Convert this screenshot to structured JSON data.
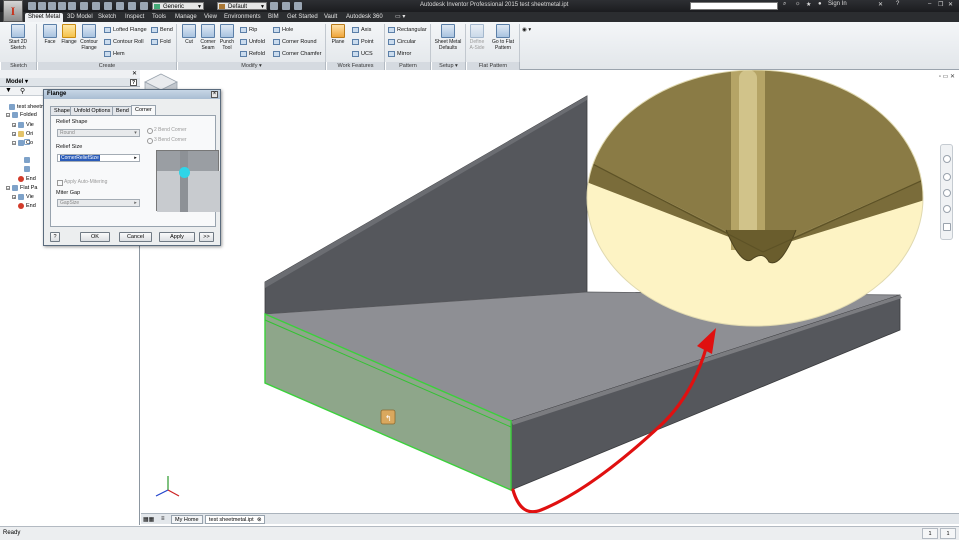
{
  "title_bar": {
    "app_title": "Autodesk Inventor Professional 2015    test sheetmetal.ipt",
    "material_dropdown": "Generic",
    "appearance_dropdown": "Default",
    "sign_in": "Sign In",
    "logo_letter": "I"
  },
  "ribbon_tabs": [
    "Sheet Metal",
    "3D Model",
    "Sketch",
    "Inspect",
    "Tools",
    "Manage",
    "View",
    "Environments",
    "BIM",
    "Get Started",
    "Vault",
    "Autodesk 360"
  ],
  "ribbon": {
    "start_sketch": "Start 2D Sketch",
    "face": "Face",
    "flange": "Flange",
    "contour_flange": "Contour Flange",
    "lofted_flange": "Lofted Flange",
    "contour_roll": "Contour Roll",
    "hem": "Hem",
    "bend": "Bend",
    "fold": "Fold",
    "cut": "Cut",
    "corner_seam": "Corner Seam",
    "punch_tool": "Punch Tool",
    "rip": "Rip",
    "unfold": "Unfold",
    "refold": "Refold",
    "hole": "Hole",
    "corner_round": "Corner Round",
    "corner_chamfer": "Corner Chamfer",
    "plane": "Plane",
    "axis": "Axis",
    "point": "Point",
    "ucs": "UCS",
    "rectangular": "Rectangular",
    "circular": "Circular",
    "mirror": "Mirror",
    "sheet_metal_defaults": "Sheet Metal Defaults",
    "define_a_side": "Define A-Side",
    "go_to_flat_pattern": "Go to Flat Pattern",
    "panels": [
      "Sketch",
      "Create",
      "Modify ▾",
      "Work Features",
      "Pattern",
      "Setup ▾",
      "Flat Pattern"
    ]
  },
  "browser": {
    "header": "Model ▾",
    "items": [
      "test sheetm",
      "Folded",
      "Vie",
      "Ori",
      "",
      "Co",
      "",
      "",
      "End",
      "Flat Pa",
      "Vie",
      "End"
    ]
  },
  "dialog": {
    "title": "Flange",
    "tabs": [
      "Shape",
      "Unfold Options",
      "Bend",
      "Corner"
    ],
    "relief_shape_label": "Relief Shape",
    "relief_shape_value": "Round",
    "relief_size_label": "Relief Size",
    "relief_size_value": "CornerReliefSize",
    "radio_2bend": "2 Bend Corner",
    "radio_3bend": "3 Bend Corner",
    "apply_auto_mitering": "Apply Auto-Mitering",
    "miter_gap_label": "Miter Gap",
    "miter_gap_value": "GapSize",
    "ok": "OK",
    "cancel": "Cancel",
    "apply": "Apply",
    "more": ">>",
    "help": "?"
  },
  "doc_tabs": [
    "My Home",
    "test sheetmetal.ipt"
  ],
  "status": {
    "text": "Ready",
    "count1": "1",
    "count2": "1"
  },
  "colors": {
    "sheet_face": "#8e8f94",
    "sheet_dark": "#55575c",
    "selected_flange": "#8ea68a",
    "zoom_bg": "#fdf3c4",
    "zoom_metal": "#8a7b45",
    "arrow": "#e01010"
  }
}
